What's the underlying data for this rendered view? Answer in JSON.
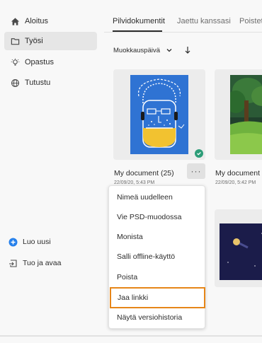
{
  "sidebar": {
    "nav": [
      {
        "label": "Aloitus",
        "icon": "home-icon"
      },
      {
        "label": "Työsi",
        "icon": "folder-icon",
        "active": true
      },
      {
        "label": "Opastus",
        "icon": "lightbulb-icon"
      },
      {
        "label": "Tutustu",
        "icon": "globe-icon"
      }
    ],
    "actions": [
      {
        "label": "Luo uusi",
        "icon": "plus-circle-icon"
      },
      {
        "label": "Tuo ja avaa",
        "icon": "import-icon"
      }
    ]
  },
  "tabs": [
    {
      "label": "Pilvidokumentit",
      "active": true
    },
    {
      "label": "Jaettu kanssasi"
    },
    {
      "label": "Poistettu"
    }
  ],
  "sort": {
    "label": "Muokkauspäivä",
    "direction_icon": "arrow-down-icon"
  },
  "documents": [
    {
      "title": "My document (25)",
      "date": "22/09/20, 5:43 PM",
      "synced": true
    },
    {
      "title": "My document (",
      "date": "22/09/20, 5:42 PM"
    }
  ],
  "context_menu": {
    "items": [
      "Nimeä uudelleen",
      "Vie PSD-muodossa",
      "Monista",
      "Salli offline-käyttö",
      "Poista",
      "Jaa linkki",
      "Näytä versiohistoria"
    ],
    "focused_index": 5
  },
  "colors": {
    "accent": "#2680eb",
    "focus": "#e68619",
    "sync_badge": "#2d9d78"
  }
}
